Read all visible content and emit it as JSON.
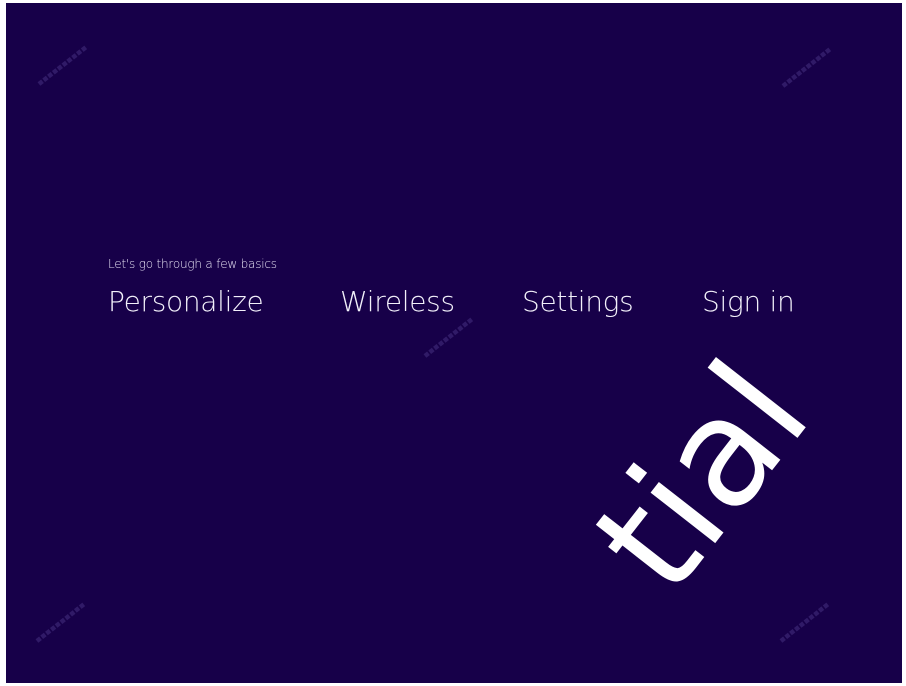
{
  "setup": {
    "subtitle": "Let's go through a few basics",
    "steps": [
      {
        "label": "Personalize"
      },
      {
        "label": "Wireless"
      },
      {
        "label": "Settings"
      },
      {
        "label": "Sign in"
      }
    ]
  },
  "watermark": {
    "large_text": "tial"
  },
  "colors": {
    "background": "#170049",
    "text": "#f2f0fa"
  }
}
